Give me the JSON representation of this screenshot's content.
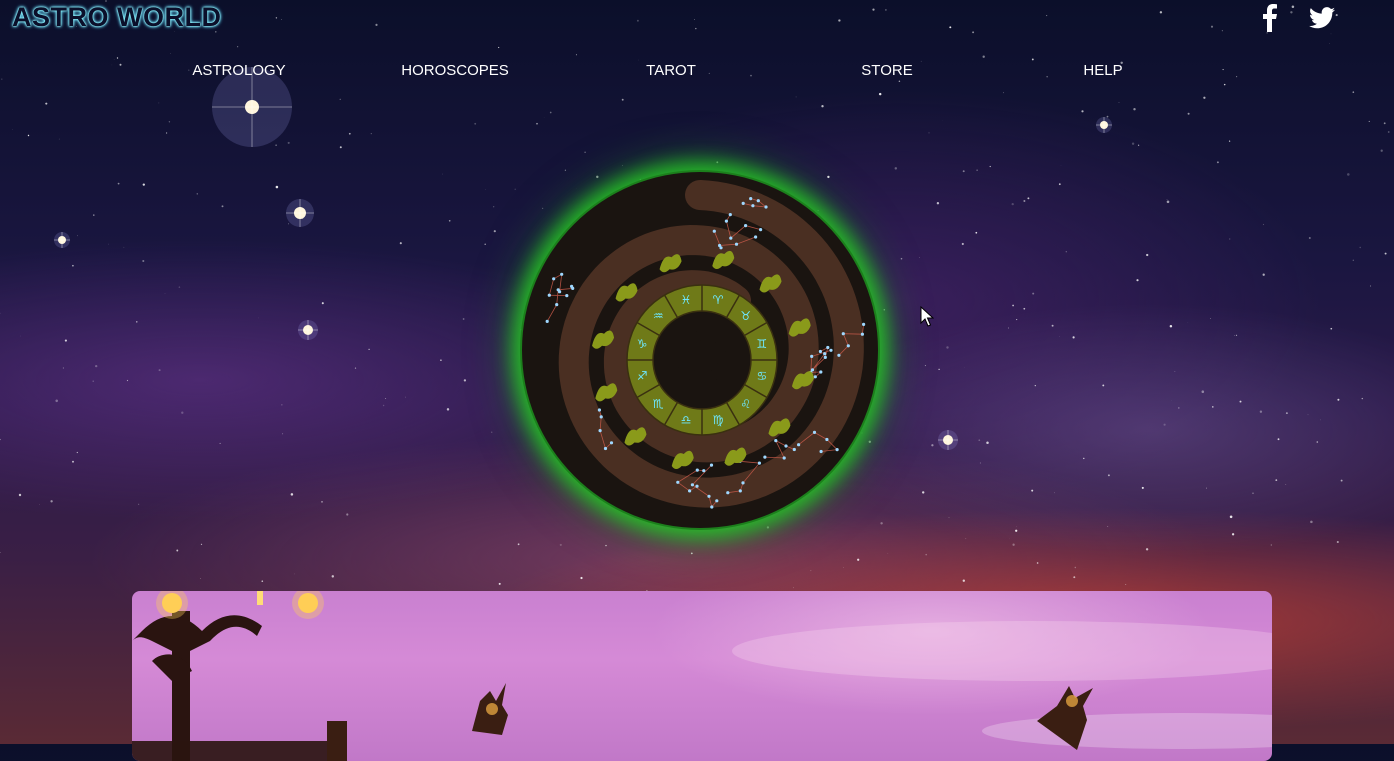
{
  "header": {
    "logo": "ASTRO WORLD",
    "social": [
      {
        "name": "facebook",
        "glyph": "f"
      },
      {
        "name": "twitter",
        "glyph": "twitter-bird"
      }
    ]
  },
  "nav": {
    "items": [
      {
        "label": "ASTROLOGY"
      },
      {
        "label": "HOROSCOPES"
      },
      {
        "label": "TAROT"
      },
      {
        "label": "STORE"
      },
      {
        "label": "HELP"
      }
    ]
  },
  "hero": {
    "image": "zodiac-wheel",
    "glow_color": "#2ecc2e"
  },
  "feature": {
    "image": "purple-sky-lampposts"
  },
  "colors": {
    "logo_glow": "#7ee8ff",
    "nav_text": "#ffffff",
    "wheel_dark": "#1a1410",
    "wheel_brown": "#4a2f22",
    "wheel_glyph": "#8a9a1a",
    "inner_ring": "#6f7a18",
    "inner_text": "#6ee7ff"
  }
}
